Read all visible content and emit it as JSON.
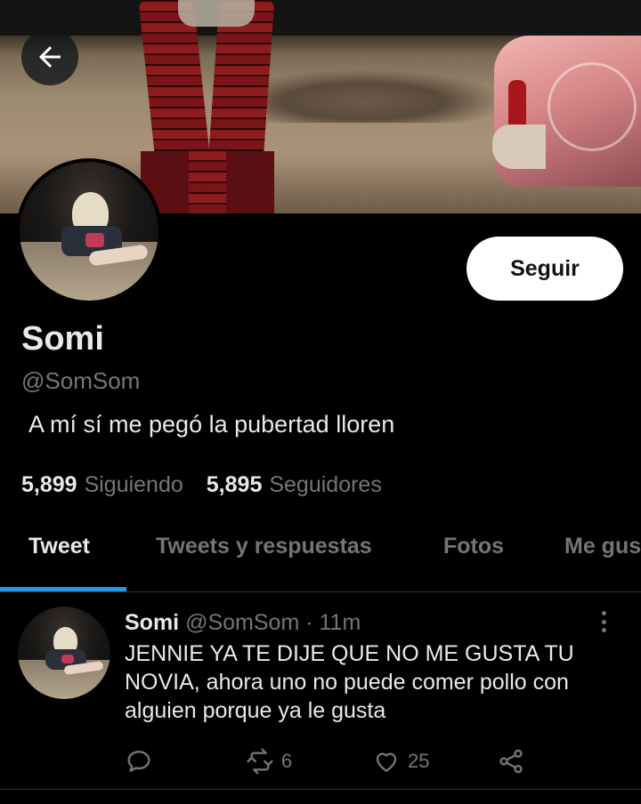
{
  "header": {
    "back_icon": "arrow-left-icon"
  },
  "profile": {
    "name": "Somi",
    "handle": "@SomSom",
    "bio": "A mí sí me pegó la pubertad lloren",
    "follow_label": "Seguir",
    "following_count": "5,899",
    "following_label": "Siguiendo",
    "followers_count": "5,895",
    "followers_label": "Seguidores"
  },
  "tabs": [
    {
      "label": "Tweet",
      "active": true
    },
    {
      "label": "Tweets y respuestas",
      "active": false
    },
    {
      "label": "Fotos",
      "active": false
    },
    {
      "label": "Me gus",
      "active": false
    }
  ],
  "tweet": {
    "name": "Somi",
    "handle": "@SomSom",
    "dot": "·",
    "time": "11m",
    "text": "JENNIE YA TE DIJE QUE NO ME GUSTA TU NOVIA, ahora uno no puede comer pollo con alguien porque ya le gusta",
    "reply_count": "",
    "retweet_count": "6",
    "like_count": "25",
    "icons": [
      "reply-icon",
      "retweet-icon",
      "like-icon",
      "share-icon",
      "more-icon"
    ]
  },
  "colors": {
    "accent": "#1d9bf0",
    "background": "#000000",
    "muted": "#71767b",
    "text": "#e7e9ea"
  }
}
